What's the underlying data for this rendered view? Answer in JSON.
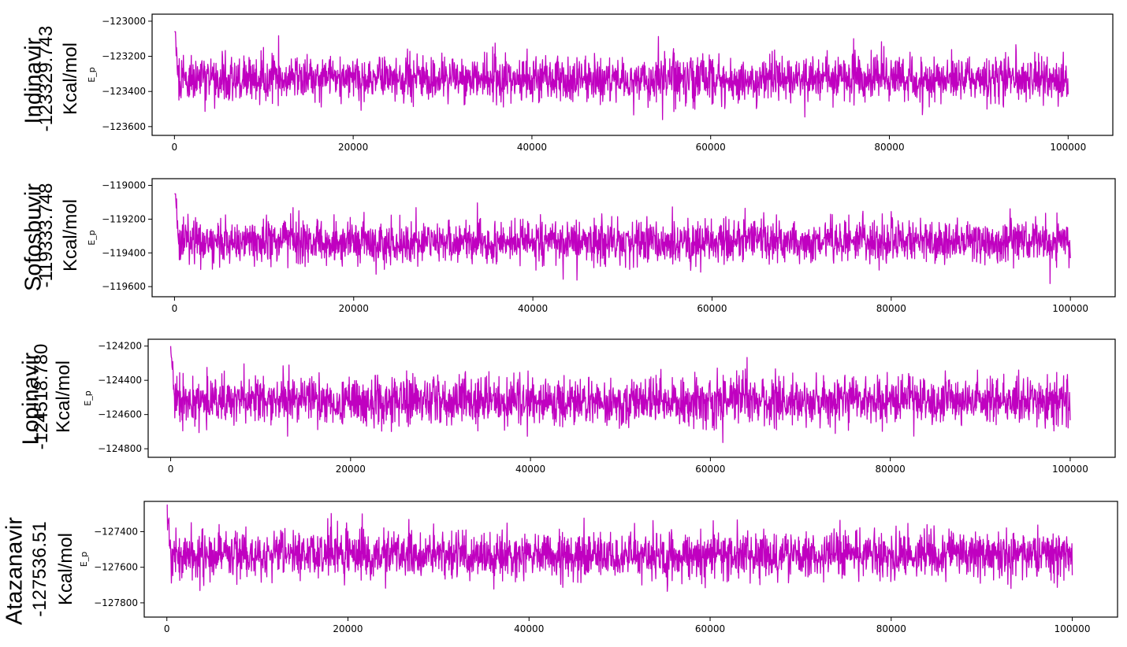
{
  "chart_data": [
    {
      "type": "line",
      "panel_label": {
        "name": "Indinavir",
        "value": "-123329.743",
        "unit": "Kcal/mol"
      },
      "ylabel": "E_p",
      "xticks": [
        "0",
        "20000",
        "40000",
        "60000",
        "80000",
        "100000"
      ],
      "yticks": [
        "-123000",
        "-123200",
        "-123400",
        "-123600"
      ],
      "xlim": [
        -2500,
        105000
      ],
      "ylim": [
        -123650,
        -122960
      ],
      "series": [
        {
          "color": "#c000c0",
          "x_range": [
            0,
            100000
          ],
          "start": -122980,
          "mean": -123330,
          "spread": 65,
          "min": -123620,
          "max": -123060
        }
      ]
    },
    {
      "type": "line",
      "panel_label": {
        "name": "Sofosbuvir",
        "value": "-119333.748",
        "unit": "Kcal/mol"
      },
      "ylabel": "E_p",
      "xticks": [
        "0",
        "20000",
        "40000",
        "60000",
        "80000",
        "100000"
      ],
      "yticks": [
        "-119000",
        "-119200",
        "-119400",
        "-119600"
      ],
      "xlim": [
        -2500,
        105000
      ],
      "ylim": [
        -119660,
        -118960
      ],
      "series": [
        {
          "color": "#c000c0",
          "x_range": [
            0,
            100000
          ],
          "start": -118960,
          "mean": -119335,
          "spread": 65,
          "min": -119630,
          "max": -119050
        }
      ]
    },
    {
      "type": "line",
      "panel_label": {
        "name": "Lopinavir",
        "value": "-124518.780",
        "unit": "Kcal/mol"
      },
      "ylabel": "E_p",
      "xticks": [
        "0",
        "20000",
        "40000",
        "60000",
        "80000",
        "100000"
      ],
      "yticks": [
        "-124200",
        "-124400",
        "-124600",
        "-124800"
      ],
      "xlim": [
        -2500,
        105000
      ],
      "ylim": [
        -124850,
        -124160
      ],
      "series": [
        {
          "color": "#c000c0",
          "x_range": [
            0,
            100000
          ],
          "start": -124200,
          "mean": -124520,
          "spread": 70,
          "min": -124820,
          "max": -124200
        }
      ]
    },
    {
      "type": "line",
      "panel_label": {
        "name": "Atazanavir",
        "value": "-127536.51",
        "unit": "Kcal/mol"
      },
      "ylabel": "E_p",
      "xticks": [
        "0",
        "20000",
        "40000",
        "60000",
        "80000",
        "100000"
      ],
      "yticks": [
        "-127400",
        "-127600",
        "-127800"
      ],
      "xlim": [
        -2500,
        105000
      ],
      "ylim": [
        -127880,
        -127230
      ],
      "series": [
        {
          "color": "#c000c0",
          "x_range": [
            0,
            100000
          ],
          "start": -127250,
          "mean": -127530,
          "spread": 65,
          "min": -127850,
          "max": -127250
        }
      ]
    }
  ]
}
